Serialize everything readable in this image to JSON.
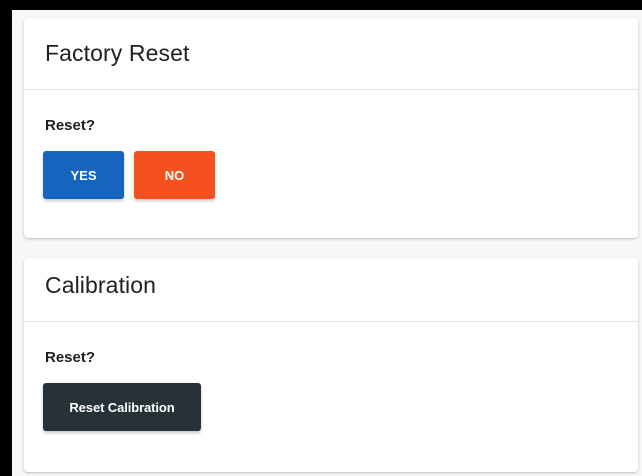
{
  "factory_reset": {
    "title": "Factory Reset",
    "prompt": "Reset?",
    "yes_label": "YES",
    "no_label": "NO"
  },
  "calibration": {
    "title": "Calibration",
    "prompt": "Reset?",
    "reset_label": "Reset Calibration"
  },
  "colors": {
    "yes": "#1565c0",
    "no": "#f4511e",
    "reset": "#263238",
    "card": "#ffffff",
    "frame": "#000000"
  }
}
